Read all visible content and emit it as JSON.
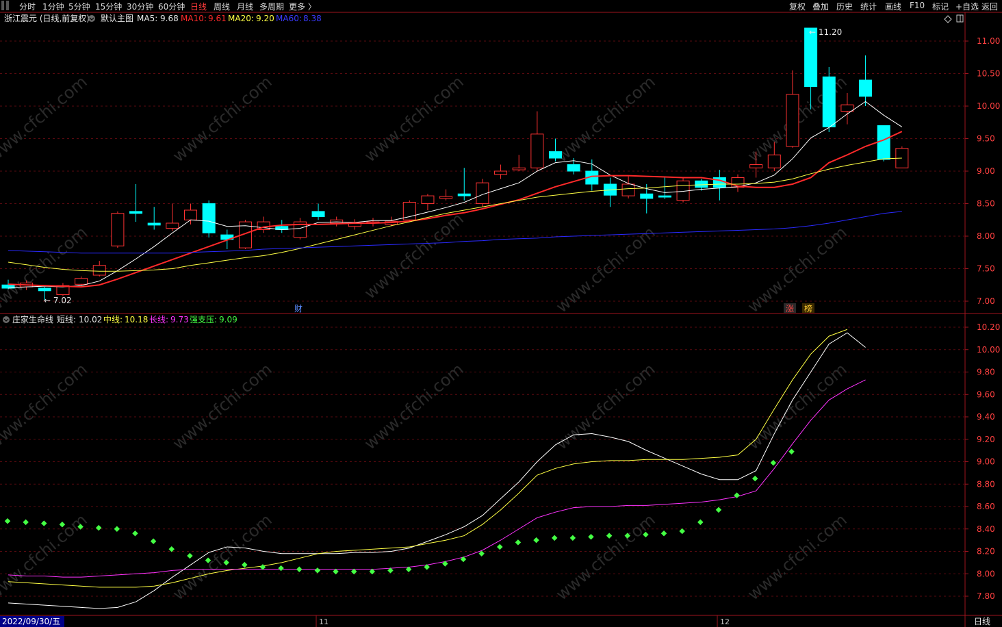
{
  "toolbar": {
    "left": [
      "分时",
      "1分钟",
      "5分钟",
      "15分钟",
      "30分钟",
      "60分钟",
      "日线",
      "周线",
      "月线",
      "多周期",
      "更多 〉"
    ],
    "active": "日线",
    "right": [
      "复权",
      "叠加",
      "历史",
      "统计",
      "画线",
      "F10",
      "标记",
      "+自选",
      "返回"
    ]
  },
  "main_header": {
    "stock": "浙江震元 (日线,前复权)",
    "template": "默认主图",
    "ma": [
      {
        "label": "MA5:",
        "value": "9.68",
        "color": "#ffffff"
      },
      {
        "label": "MA10:",
        "value": "9.61",
        "color": "#ff2a2a"
      },
      {
        "label": "MA20:",
        "value": "9.20",
        "color": "#ffff44"
      },
      {
        "label": "MA60:",
        "value": "8.38",
        "color": "#2a2aff"
      }
    ]
  },
  "sub_header": {
    "indicator": "庄家生命线",
    "lines": [
      {
        "label": "短线:",
        "value": "10.02",
        "color": "#ffffff"
      },
      {
        "label": "中线:",
        "value": "10.18",
        "color": "#ffff44"
      },
      {
        "label": "长线:",
        "value": "9.73",
        "color": "#ff33ff"
      },
      {
        "label": "强支压:",
        "value": "9.09",
        "color": "#44ff44"
      }
    ]
  },
  "annotations": {
    "high": "11.20",
    "low": "7.02",
    "news_mark": "财",
    "flags": [
      "涨",
      "榜"
    ]
  },
  "main_y_ticks": [
    "11.00",
    "10.50",
    "10.00",
    "9.50",
    "9.00",
    "8.50",
    "8.00",
    "7.50",
    "7.00"
  ],
  "sub_y_ticks": [
    "10.20",
    "10.00",
    "9.80",
    "9.60",
    "9.40",
    "9.20",
    "9.00",
    "8.80",
    "8.60",
    "8.40",
    "8.20",
    "8.00",
    "7.80"
  ],
  "x_axis": {
    "date_label": "2022/09/30/五",
    "months": [
      "11",
      "12"
    ],
    "period": "日线"
  },
  "watermark": "www.cfchi.com",
  "colors": {
    "up": "#ff3232",
    "down": "#00ffff",
    "ma5": "#ffffff",
    "ma10": "#ff2a2a",
    "ma20": "#ffff44",
    "ma60": "#2a2aff",
    "short": "#ffffff",
    "mid": "#ffff44",
    "long": "#ff33ff",
    "support": "#44ff44",
    "axis": "#a0141e"
  },
  "chart_data": [
    {
      "type": "candlestick",
      "title": "浙江震元 (日线,前复权)",
      "ylim": [
        6.85,
        11.35
      ],
      "candles": [
        [
          7.25,
          7.2,
          7.33,
          7.18
        ],
        [
          7.22,
          7.28,
          7.32,
          7.17
        ],
        [
          7.2,
          7.16,
          7.22,
          7.02
        ],
        [
          7.1,
          7.24,
          7.28,
          7.08
        ],
        [
          7.26,
          7.35,
          7.38,
          7.24
        ],
        [
          7.4,
          7.55,
          7.62,
          7.38
        ],
        [
          7.85,
          8.35,
          8.38,
          7.82
        ],
        [
          8.38,
          8.35,
          8.8,
          8.22
        ],
        [
          8.2,
          8.17,
          8.45,
          8.1
        ],
        [
          8.12,
          8.2,
          8.5,
          8.08
        ],
        [
          8.25,
          8.4,
          8.5,
          8.18
        ],
        [
          8.5,
          8.05,
          8.55,
          7.98
        ],
        [
          8.02,
          7.95,
          8.1,
          7.8
        ],
        [
          7.82,
          8.22,
          8.25,
          7.8
        ],
        [
          8.1,
          8.22,
          8.3,
          8.05
        ],
        [
          8.15,
          8.1,
          8.25,
          8.05
        ],
        [
          7.98,
          8.22,
          8.28,
          7.95
        ],
        [
          8.38,
          8.3,
          8.5,
          8.25
        ],
        [
          8.2,
          8.25,
          8.3,
          8.15
        ],
        [
          8.15,
          8.2,
          8.26,
          8.1
        ],
        [
          8.2,
          8.22,
          8.28,
          8.15
        ],
        [
          8.18,
          8.23,
          8.3,
          8.15
        ],
        [
          8.25,
          8.52,
          8.55,
          8.22
        ],
        [
          8.5,
          8.62,
          8.65,
          8.4
        ],
        [
          8.58,
          8.61,
          8.72,
          8.55
        ],
        [
          8.65,
          8.62,
          9.05,
          8.55
        ],
        [
          8.5,
          8.82,
          8.88,
          8.45
        ],
        [
          8.95,
          9.0,
          9.1,
          8.88
        ],
        [
          9.02,
          9.05,
          9.25,
          9.0
        ],
        [
          9.05,
          9.57,
          9.92,
          9.0
        ],
        [
          9.3,
          9.2,
          9.5,
          9.15
        ],
        [
          9.1,
          9.0,
          9.2,
          8.95
        ],
        [
          9.0,
          8.8,
          9.18,
          8.7
        ],
        [
          8.8,
          8.63,
          8.9,
          8.45
        ],
        [
          8.62,
          8.8,
          8.92,
          8.58
        ],
        [
          8.65,
          8.58,
          8.8,
          8.35
        ],
        [
          8.62,
          8.6,
          8.9,
          8.57
        ],
        [
          8.55,
          8.85,
          8.9,
          8.52
        ],
        [
          8.85,
          8.75,
          8.88,
          8.7
        ],
        [
          8.9,
          8.75,
          9.02,
          8.55
        ],
        [
          8.75,
          8.9,
          8.95,
          8.68
        ],
        [
          9.05,
          9.1,
          9.3,
          8.9
        ],
        [
          9.05,
          9.25,
          9.45,
          9.0
        ],
        [
          9.38,
          10.18,
          10.55,
          9.36
        ],
        [
          11.2,
          10.3,
          11.2,
          9.95
        ],
        [
          10.45,
          9.68,
          10.6,
          9.6
        ],
        [
          9.92,
          10.02,
          10.2,
          9.72
        ],
        [
          10.4,
          10.15,
          10.78,
          10.0
        ],
        [
          9.7,
          9.18,
          9.7,
          9.15
        ],
        [
          9.05,
          9.35,
          9.38,
          9.05
        ]
      ],
      "series": [
        {
          "name": "MA5",
          "values": [
            7.2,
            7.22,
            7.23,
            7.22,
            7.24,
            7.31,
            7.47,
            7.65,
            7.84,
            8.05,
            8.25,
            8.23,
            8.15,
            8.16,
            8.13,
            8.1,
            8.12,
            8.21,
            8.22,
            8.21,
            8.24,
            8.24,
            8.3,
            8.37,
            8.44,
            8.52,
            8.64,
            8.73,
            8.82,
            9.0,
            9.13,
            9.16,
            9.11,
            8.94,
            8.81,
            8.73,
            8.67,
            8.69,
            8.72,
            8.74,
            8.76,
            8.82,
            8.94,
            9.19,
            9.51,
            9.67,
            9.88,
            10.07,
            9.86,
            9.68
          ]
        },
        {
          "name": "MA10",
          "values": [
            7.26,
            7.25,
            7.24,
            7.23,
            7.22,
            7.25,
            7.34,
            7.44,
            7.54,
            7.64,
            7.74,
            7.84,
            7.94,
            8.04,
            8.14,
            8.17,
            8.18,
            8.18,
            8.19,
            8.2,
            8.2,
            8.21,
            8.23,
            8.27,
            8.32,
            8.36,
            8.42,
            8.49,
            8.56,
            8.66,
            8.76,
            8.84,
            8.92,
            8.93,
            8.93,
            8.92,
            8.91,
            8.9,
            8.9,
            8.86,
            8.77,
            8.75,
            8.75,
            8.8,
            8.9,
            9.13,
            9.25,
            9.38,
            9.48,
            9.61
          ]
        },
        {
          "name": "MA20",
          "values": [
            7.6,
            7.56,
            7.52,
            7.49,
            7.47,
            7.46,
            7.46,
            7.47,
            7.48,
            7.5,
            7.55,
            7.59,
            7.63,
            7.67,
            7.7,
            7.75,
            7.81,
            7.88,
            7.95,
            8.02,
            8.09,
            8.16,
            8.22,
            8.29,
            8.35,
            8.4,
            8.45,
            8.5,
            8.55,
            8.6,
            8.63,
            8.66,
            8.69,
            8.71,
            8.73,
            8.74,
            8.76,
            8.78,
            8.79,
            8.8,
            8.8,
            8.81,
            8.83,
            8.88,
            8.96,
            9.03,
            9.09,
            9.14,
            9.19,
            9.2
          ]
        },
        {
          "name": "MA60",
          "values": [
            7.78,
            7.77,
            7.76,
            7.75,
            7.74,
            7.74,
            7.74,
            7.74,
            7.74,
            7.74,
            7.75,
            7.76,
            7.77,
            7.78,
            7.8,
            7.81,
            7.82,
            7.83,
            7.84,
            7.85,
            7.86,
            7.87,
            7.88,
            7.89,
            7.9,
            7.92,
            7.93,
            7.95,
            7.96,
            7.97,
            7.99,
            8.0,
            8.01,
            8.02,
            8.03,
            8.04,
            8.05,
            8.06,
            8.07,
            8.08,
            8.09,
            8.1,
            8.11,
            8.13,
            8.16,
            8.2,
            8.25,
            8.3,
            8.35,
            8.38
          ]
        }
      ]
    },
    {
      "type": "line",
      "title": "庄家生命线",
      "ylim": [
        7.58,
        10.34
      ],
      "series": [
        {
          "name": "短线",
          "values": [
            7.74,
            7.73,
            7.72,
            7.71,
            7.7,
            7.69,
            7.7,
            7.75,
            7.85,
            7.97,
            8.08,
            8.19,
            8.24,
            8.23,
            8.2,
            8.18,
            8.18,
            8.18,
            8.18,
            8.19,
            8.19,
            8.2,
            8.23,
            8.29,
            8.35,
            8.42,
            8.52,
            8.67,
            8.82,
            9.0,
            9.15,
            9.24,
            9.25,
            9.22,
            9.18,
            9.1,
            9.03,
            8.96,
            8.89,
            8.84,
            8.84,
            8.92,
            9.25,
            9.55,
            9.8,
            10.05,
            10.15,
            10.02
          ]
        },
        {
          "name": "中线",
          "values": [
            7.93,
            7.92,
            7.91,
            7.9,
            7.89,
            7.88,
            7.88,
            7.88,
            7.89,
            7.92,
            7.96,
            8.0,
            8.03,
            8.05,
            8.07,
            8.1,
            8.14,
            8.18,
            8.2,
            8.21,
            8.22,
            8.23,
            8.24,
            8.27,
            8.3,
            8.34,
            8.44,
            8.57,
            8.72,
            8.88,
            8.94,
            8.98,
            9.0,
            9.01,
            9.01,
            9.02,
            9.02,
            9.02,
            9.03,
            9.04,
            9.06,
            9.2,
            9.47,
            9.73,
            9.96,
            10.12,
            10.18
          ]
        },
        {
          "name": "长线",
          "values": [
            7.99,
            7.98,
            7.98,
            7.97,
            7.97,
            7.98,
            7.99,
            8.0,
            8.01,
            8.03,
            8.04,
            8.04,
            8.04,
            8.04,
            8.04,
            8.04,
            8.04,
            8.04,
            8.04,
            8.04,
            8.04,
            8.05,
            8.06,
            8.08,
            8.11,
            8.15,
            8.21,
            8.3,
            8.4,
            8.5,
            8.55,
            8.59,
            8.6,
            8.6,
            8.61,
            8.61,
            8.62,
            8.63,
            8.64,
            8.66,
            8.69,
            8.74,
            8.94,
            9.16,
            9.37,
            9.55,
            9.65,
            9.73
          ]
        },
        {
          "name": "强支压",
          "values": [
            8.47,
            8.46,
            8.45,
            8.44,
            8.42,
            8.41,
            8.4,
            8.36,
            8.29,
            8.22,
            8.16,
            8.12,
            8.1,
            8.08,
            8.06,
            8.05,
            8.04,
            8.03,
            8.02,
            8.02,
            8.02,
            8.03,
            8.04,
            8.06,
            8.09,
            8.13,
            8.18,
            8.24,
            8.28,
            8.3,
            8.32,
            8.32,
            8.33,
            8.34,
            8.34,
            8.35,
            8.36,
            8.38,
            8.46,
            8.57,
            8.7,
            8.85,
            8.99,
            9.09
          ]
        }
      ]
    }
  ]
}
